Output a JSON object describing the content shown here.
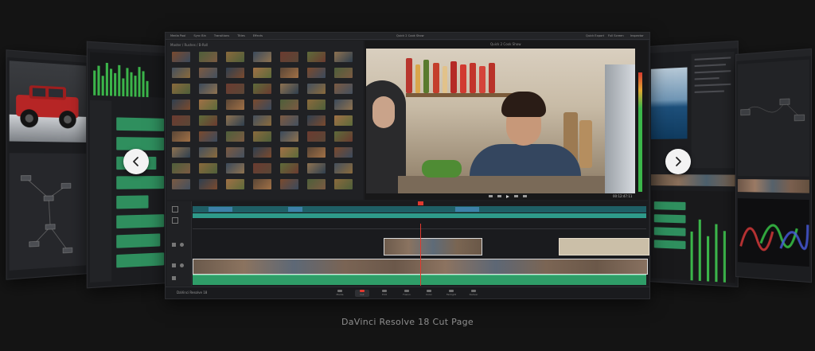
{
  "caption": "DaVinci Resolve 18 Cut Page",
  "main_window": {
    "title": "Quick 2 Cook Show",
    "menu_tabs": [
      "Media Pool",
      "Sync Bin",
      "Transitions",
      "Titles",
      "Effects"
    ],
    "bin_path": "Master / Rushes / B-Roll",
    "viewer_label": "Quick 2 Cook Show",
    "timecode": "00:12:47:11",
    "right_tools": [
      "Quick Export",
      "Full Screen",
      "Inspector"
    ],
    "app_label": "DaVinci Resolve 18",
    "pages": [
      "Media",
      "Cut",
      "Edit",
      "Fusion",
      "Color",
      "Fairlight",
      "Deliver"
    ]
  },
  "colors": {
    "background": "#141414",
    "panel": "#1c1d20",
    "timeline_teal": "#2e9a8a",
    "audio_green": "#33a56b",
    "playhead": "#e0392f"
  }
}
